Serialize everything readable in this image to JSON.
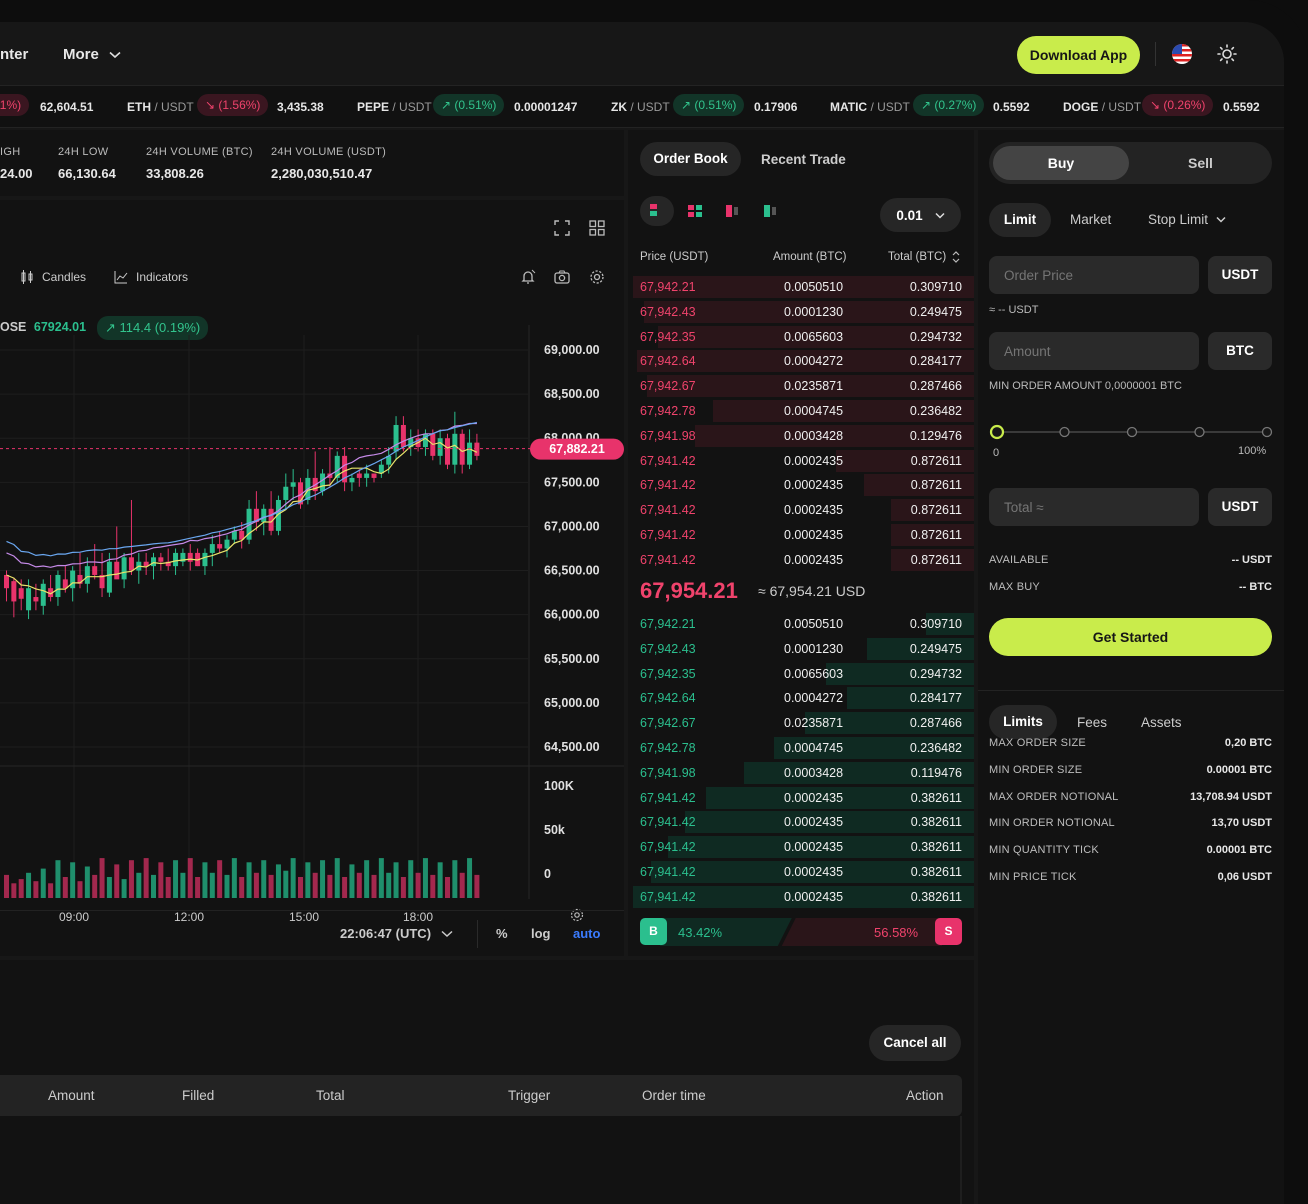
{
  "nav": {
    "center_partial": "nter",
    "more": "More",
    "download": "Download App"
  },
  "ticker": [
    {
      "pair": "",
      "quote": "",
      "chg": "11%)",
      "dir": "down",
      "price": "62,604.51"
    },
    {
      "pair": "ETH",
      "quote": "/ USDT",
      "chg": "(1.56%)",
      "dir": "down",
      "price": "3,435.38"
    },
    {
      "pair": "PEPE",
      "quote": "/ USDT",
      "chg": "(0.51%)",
      "dir": "up",
      "price": "0.00001247"
    },
    {
      "pair": "ZK",
      "quote": "/ USDT",
      "chg": "(0.51%)",
      "dir": "up",
      "price": "0.17906"
    },
    {
      "pair": "MATIC",
      "quote": "/ USDT",
      "chg": "(0.27%)",
      "dir": "up",
      "price": "0.5592"
    },
    {
      "pair": "DOGE",
      "quote": "/ USDT",
      "chg": "(0.26%)",
      "dir": "down",
      "price": "0.5592"
    }
  ],
  "stats": [
    {
      "label": "IGH",
      "value": "24.00"
    },
    {
      "label": "24H LOW",
      "value": "66,130.64"
    },
    {
      "label": "24H VOLUME (BTC)",
      "value": "33,808.26"
    },
    {
      "label": "24H VOLUME (USDT)",
      "value": "2,280,030,510.47"
    }
  ],
  "chart_toolbar": {
    "candles": "Candles",
    "indicators": "Indicators"
  },
  "legend": {
    "close_label": "OSE",
    "close_value": "67924.01",
    "change": "114.4 (0.19%)"
  },
  "chart_footer": {
    "time": "22:06:47 (UTC)",
    "percent": "%",
    "log": "log",
    "auto": "auto"
  },
  "chart_data": {
    "type": "candlestick",
    "y_ticks": [
      "69,000.00",
      "68,500.00",
      "68,000.00",
      "67,500.00",
      "67,000.00",
      "66,500.00",
      "66,000.00",
      "65,500.00",
      "65,000.00",
      "64,500.00"
    ],
    "ylim": [
      64300,
      69100
    ],
    "x_ticks": [
      "09:00",
      "12:00",
      "15:00",
      "18:00"
    ],
    "volume_ticks": [
      "100K",
      "50k",
      "0"
    ],
    "current_price": "67,882.21",
    "current_price_value": 67882.21,
    "candles": [
      {
        "o": 66300,
        "h": 66500,
        "l": 66150,
        "c": 66450,
        "u": 0
      },
      {
        "o": 66150,
        "h": 66420,
        "l": 65970,
        "c": 66380,
        "u": 0
      },
      {
        "o": 66300,
        "h": 66400,
        "l": 66050,
        "c": 66180,
        "u": 0
      },
      {
        "o": 66050,
        "h": 66400,
        "l": 65950,
        "c": 66300,
        "u": 1
      },
      {
        "o": 66200,
        "h": 66350,
        "l": 66050,
        "c": 66150,
        "u": 0
      },
      {
        "o": 66100,
        "h": 66400,
        "l": 66000,
        "c": 66350,
        "u": 1
      },
      {
        "o": 66300,
        "h": 66450,
        "l": 66150,
        "c": 66200,
        "u": 0
      },
      {
        "o": 66200,
        "h": 66500,
        "l": 66100,
        "c": 66450,
        "u": 1
      },
      {
        "o": 66400,
        "h": 66550,
        "l": 66250,
        "c": 66300,
        "u": 0
      },
      {
        "o": 66300,
        "h": 66550,
        "l": 66150,
        "c": 66500,
        "u": 1
      },
      {
        "o": 66450,
        "h": 66700,
        "l": 66300,
        "c": 66350,
        "u": 0
      },
      {
        "o": 66350,
        "h": 66650,
        "l": 66250,
        "c": 66550,
        "u": 1
      },
      {
        "o": 66550,
        "h": 66800,
        "l": 66400,
        "c": 66450,
        "u": 0
      },
      {
        "o": 66450,
        "h": 66700,
        "l": 66200,
        "c": 66300,
        "u": 0
      },
      {
        "o": 66250,
        "h": 66700,
        "l": 66200,
        "c": 66600,
        "u": 1
      },
      {
        "o": 66600,
        "h": 67000,
        "l": 66450,
        "c": 66400,
        "u": 0
      },
      {
        "o": 66400,
        "h": 66700,
        "l": 66300,
        "c": 66650,
        "u": 1
      },
      {
        "o": 66650,
        "h": 67300,
        "l": 66450,
        "c": 66500,
        "u": 0
      },
      {
        "o": 66500,
        "h": 66700,
        "l": 66350,
        "c": 66600,
        "u": 1
      },
      {
        "o": 66600,
        "h": 66700,
        "l": 66450,
        "c": 66550,
        "u": 0
      },
      {
        "o": 66550,
        "h": 66700,
        "l": 66400,
        "c": 66650,
        "u": 1
      },
      {
        "o": 66650,
        "h": 66700,
        "l": 66500,
        "c": 66600,
        "u": 0
      },
      {
        "o": 66600,
        "h": 66750,
        "l": 66500,
        "c": 66550,
        "u": 0
      },
      {
        "o": 66550,
        "h": 66750,
        "l": 66450,
        "c": 66700,
        "u": 1
      },
      {
        "o": 66700,
        "h": 66750,
        "l": 66550,
        "c": 66600,
        "u": 1
      },
      {
        "o": 66600,
        "h": 66800,
        "l": 66500,
        "c": 66700,
        "u": 0
      },
      {
        "o": 66700,
        "h": 66750,
        "l": 66550,
        "c": 66550,
        "u": 0
      },
      {
        "o": 66550,
        "h": 66750,
        "l": 66450,
        "c": 66700,
        "u": 1
      },
      {
        "o": 66700,
        "h": 66900,
        "l": 66550,
        "c": 66800,
        "u": 1
      },
      {
        "o": 66800,
        "h": 66950,
        "l": 66700,
        "c": 66750,
        "u": 0
      },
      {
        "o": 66750,
        "h": 66900,
        "l": 66650,
        "c": 66850,
        "u": 1
      },
      {
        "o": 66850,
        "h": 67000,
        "l": 66800,
        "c": 66950,
        "u": 1
      },
      {
        "o": 66950,
        "h": 67050,
        "l": 66750,
        "c": 66850,
        "u": 0
      },
      {
        "o": 66850,
        "h": 67300,
        "l": 66800,
        "c": 67200,
        "u": 1
      },
      {
        "o": 67200,
        "h": 67400,
        "l": 66950,
        "c": 67050,
        "u": 0
      },
      {
        "o": 67050,
        "h": 67250,
        "l": 66900,
        "c": 67200,
        "u": 1
      },
      {
        "o": 67200,
        "h": 67400,
        "l": 66900,
        "c": 66950,
        "u": 0
      },
      {
        "o": 66950,
        "h": 67350,
        "l": 66900,
        "c": 67300,
        "u": 1
      },
      {
        "o": 67300,
        "h": 67600,
        "l": 67200,
        "c": 67450,
        "u": 1
      },
      {
        "o": 67450,
        "h": 67650,
        "l": 67300,
        "c": 67500,
        "u": 1
      },
      {
        "o": 67500,
        "h": 67550,
        "l": 67200,
        "c": 67250,
        "u": 0
      },
      {
        "o": 67300,
        "h": 67650,
        "l": 67250,
        "c": 67550,
        "u": 1
      },
      {
        "o": 67550,
        "h": 67850,
        "l": 67300,
        "c": 67400,
        "u": 0
      },
      {
        "o": 67400,
        "h": 67650,
        "l": 67350,
        "c": 67600,
        "u": 1
      },
      {
        "o": 67600,
        "h": 67900,
        "l": 67450,
        "c": 67550,
        "u": 0
      },
      {
        "o": 67550,
        "h": 67850,
        "l": 67500,
        "c": 67800,
        "u": 1
      },
      {
        "o": 67500,
        "h": 67900,
        "l": 67400,
        "c": 67800,
        "u": 0
      },
      {
        "o": 67500,
        "h": 67600,
        "l": 67400,
        "c": 67550,
        "u": 1
      },
      {
        "o": 67550,
        "h": 67650,
        "l": 67450,
        "c": 67600,
        "u": 0
      },
      {
        "o": 67600,
        "h": 67700,
        "l": 67450,
        "c": 67550,
        "u": 1
      },
      {
        "o": 67550,
        "h": 67600,
        "l": 67500,
        "c": 67600,
        "u": 0
      },
      {
        "o": 67600,
        "h": 67750,
        "l": 67550,
        "c": 67700,
        "u": 1
      },
      {
        "o": 67700,
        "h": 67900,
        "l": 67600,
        "c": 67800,
        "u": 1
      },
      {
        "o": 67850,
        "h": 68250,
        "l": 67750,
        "c": 68150,
        "u": 1
      },
      {
        "o": 68150,
        "h": 68250,
        "l": 67850,
        "c": 67900,
        "u": 0
      },
      {
        "o": 67900,
        "h": 68100,
        "l": 67800,
        "c": 68000,
        "u": 1
      },
      {
        "o": 68000,
        "h": 68100,
        "l": 67850,
        "c": 67900,
        "u": 0
      },
      {
        "o": 67900,
        "h": 68100,
        "l": 67800,
        "c": 68050,
        "u": 1
      },
      {
        "o": 68050,
        "h": 68100,
        "l": 67750,
        "c": 67800,
        "u": 0
      },
      {
        "o": 67800,
        "h": 68100,
        "l": 67700,
        "c": 68000,
        "u": 1
      },
      {
        "o": 68000,
        "h": 68050,
        "l": 67650,
        "c": 67700,
        "u": 0
      },
      {
        "o": 67700,
        "h": 68300,
        "l": 67600,
        "c": 68050,
        "u": 1
      },
      {
        "o": 68050,
        "h": 68100,
        "l": 67600,
        "c": 67700,
        "u": 0
      },
      {
        "o": 67700,
        "h": 68100,
        "l": 67650,
        "c": 67950,
        "u": 1
      },
      {
        "o": 67950,
        "h": 68050,
        "l": 67750,
        "c": 67800,
        "u": 0
      }
    ],
    "volumes": [
      0.55,
      0.35,
      0.45,
      0.6,
      0.4,
      0.7,
      0.35,
      0.9,
      0.5,
      0.85,
      0.4,
      0.75,
      0.55,
      0.95,
      0.5,
      0.8,
      0.45,
      0.9,
      0.6,
      0.95,
      0.55,
      0.85,
      0.5,
      0.9,
      0.6,
      0.95,
      0.5,
      0.85,
      0.6,
      0.9,
      0.55,
      0.95,
      0.5,
      0.85,
      0.6,
      0.9,
      0.55,
      0.8,
      0.65,
      0.95,
      0.5,
      0.85,
      0.6,
      0.9,
      0.55,
      0.95,
      0.5,
      0.8,
      0.6,
      0.9,
      0.55,
      0.95,
      0.6,
      0.85,
      0.5,
      0.9,
      0.6,
      0.95,
      0.55,
      0.85,
      0.5,
      0.9,
      0.6,
      0.95,
      0.55
    ]
  },
  "orderbook": {
    "tabs": [
      "Order Book",
      "Recent Trade"
    ],
    "precision": "0.01",
    "headers": [
      "Price (USDT)",
      "Amount (BTC)",
      "Total (BTC)"
    ],
    "asks": [
      {
        "price": "67,942.21",
        "amount": "0.0050510",
        "total": "0.309710",
        "depth": 0.99
      },
      {
        "price": "67,942.43",
        "amount": "0.0001230",
        "total": "0.249475",
        "depth": 0.96
      },
      {
        "price": "67,942.35",
        "amount": "0.0065603",
        "total": "0.294732",
        "depth": 0.92
      },
      {
        "price": "67,942.64",
        "amount": "0.0004272",
        "total": "0.284177",
        "depth": 0.98
      },
      {
        "price": "67,942.67",
        "amount": "0.0235871",
        "total": "0.287466",
        "depth": 0.95
      },
      {
        "price": "67,942.78",
        "amount": "0.0004745",
        "total": "0.236482",
        "depth": 0.76
      },
      {
        "price": "67,941.98",
        "amount": "0.0003428",
        "total": "0.129476",
        "depth": 0.81
      },
      {
        "price": "67,941.42",
        "amount": "0.0002435",
        "total": "0.872611",
        "depth": 0.4
      },
      {
        "price": "67,941.42",
        "amount": "0.0002435",
        "total": "0.872611",
        "depth": 0.32
      },
      {
        "price": "67,941.42",
        "amount": "0.0002435",
        "total": "0.872611",
        "depth": 0.24
      },
      {
        "price": "67,941.42",
        "amount": "0.0002435",
        "total": "0.872611",
        "depth": 0.24
      },
      {
        "price": "67,941.42",
        "amount": "0.0002435",
        "total": "0.872611",
        "depth": 0.24
      }
    ],
    "last_price": "67,954.21",
    "last_usd": "≈ 67,954.21 USD",
    "bids": [
      {
        "price": "67,942.21",
        "amount": "0.0050510",
        "total": "0.309710",
        "depth": 0.14
      },
      {
        "price": "67,942.43",
        "amount": "0.0001230",
        "total": "0.249475",
        "depth": 0.31
      },
      {
        "price": "67,942.35",
        "amount": "0.0065603",
        "total": "0.294732",
        "depth": 0.43
      },
      {
        "price": "67,942.64",
        "amount": "0.0004272",
        "total": "0.284177",
        "depth": 0.37
      },
      {
        "price": "67,942.67",
        "amount": "0.0235871",
        "total": "0.287466",
        "depth": 0.49
      },
      {
        "price": "67,942.78",
        "amount": "0.0004745",
        "total": "0.236482",
        "depth": 0.58
      },
      {
        "price": "67,941.98",
        "amount": "0.0003428",
        "total": "0.119476",
        "depth": 0.67
      },
      {
        "price": "67,941.42",
        "amount": "0.0002435",
        "total": "0.382611",
        "depth": 0.78
      },
      {
        "price": "67,941.42",
        "amount": "0.0002435",
        "total": "0.382611",
        "depth": 0.84
      },
      {
        "price": "67,941.42",
        "amount": "0.0002435",
        "total": "0.382611",
        "depth": 0.89
      },
      {
        "price": "67,941.42",
        "amount": "0.0002435",
        "total": "0.382611",
        "depth": 0.94
      },
      {
        "price": "67,941.42",
        "amount": "0.0002435",
        "total": "0.382611",
        "depth": 0.99
      }
    ],
    "buy_label": "B",
    "buy_pct": "43.42%",
    "sell_pct": "56.58%",
    "sell_label": "S",
    "buy_ratio": 0.4342
  },
  "trade": {
    "buy": "Buy",
    "sell": "Sell",
    "order_types": [
      "Limit",
      "Market",
      "Stop Limit"
    ],
    "order_price_placeholder": "Order Price",
    "order_price_unit": "USDT",
    "approx": "≈ -- USDT",
    "amount_placeholder": "Amount",
    "amount_unit": "BTC",
    "min_order": "MIN ORDER AMOUNT 0,0000001 BTC",
    "slider_min": "0",
    "slider_max": "100%",
    "slider_value": 0,
    "total_placeholder": "Total ≈",
    "total_unit": "USDT",
    "available_label": "AVAILABLE",
    "available_value": "-- USDT",
    "maxbuy_label": "MAX BUY",
    "maxbuy_value": "-- BTC",
    "cta": "Get Started"
  },
  "info": {
    "tabs": [
      "Limits",
      "Fees",
      "Assets"
    ],
    "rows": [
      {
        "label": "MAX ORDER SIZE",
        "value": "0,20 BTC"
      },
      {
        "label": "MIN ORDER SIZE",
        "value": "0.00001 BTC"
      },
      {
        "label": "MAX ORDER NOTIONAL",
        "value": "13,708.94 USDT"
      },
      {
        "label": "MIN ORDER NOTIONAL",
        "value": "13,70 USDT"
      },
      {
        "label": "MIN QUANTITY TICK",
        "value": "0.00001 BTC"
      },
      {
        "label": "MIN PRICE TICK",
        "value": "0,06 USDT"
      }
    ]
  },
  "orders": {
    "cancel_all": "Cancel all",
    "columns": [
      "Amount",
      "Filled",
      "Total",
      "Trigger",
      "Order time",
      "Action"
    ]
  },
  "colors": {
    "up": "#2bbf8e",
    "down": "#e8336b",
    "accent": "#c9ec4b",
    "auto": "#3b7cff"
  }
}
